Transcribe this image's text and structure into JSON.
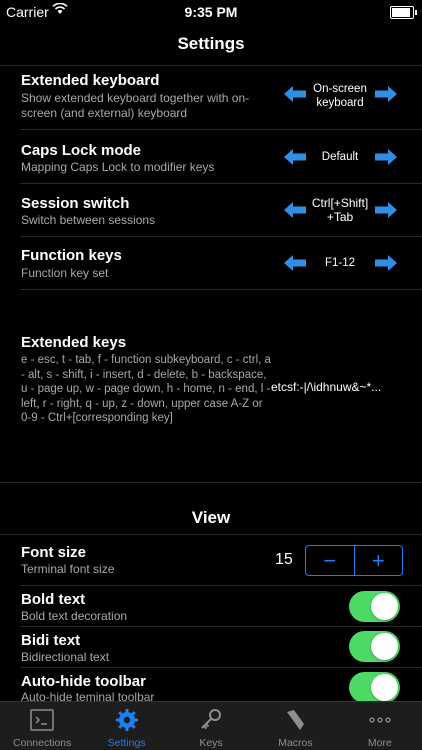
{
  "status_bar": {
    "carrier": "Carrier",
    "time": "9:35 PM",
    "battery_level": 1.0
  },
  "nav": {
    "title": "Settings"
  },
  "settings": {
    "extended_keyboard": {
      "title": "Extended keyboard",
      "subtitle": "Show extended keyboard together with on-screen (and external) keyboard",
      "value": "On-screen keyboard"
    },
    "caps_lock": {
      "title": "Caps Lock mode",
      "subtitle": "Mapping Caps Lock to modifier keys",
      "value": "Default"
    },
    "session_switch": {
      "title": "Session switch",
      "subtitle": "Switch between sessions",
      "value": "Ctrl[+Shift] +Tab"
    },
    "function_keys": {
      "title": "Function keys",
      "subtitle": "Function key set",
      "value": "F1-12"
    },
    "extended_keys": {
      "title": "Extended keys",
      "description": "e - esc, t - tab, f - function subkeyboard, c - ctrl, a - alt, s - shift, i - insert, d - delete, b - backspace, u - page up, w - page down, h - home, n - end, l - left, r - right, q - up, z - down, upper case A-Z or 0-9 - Ctrl+[corresponding key]",
      "value": "etcsf:-|/\\idhnuw&~*..."
    }
  },
  "view_section": {
    "header": "View",
    "font_size": {
      "title": "Font size",
      "subtitle": "Terminal font size",
      "value": "15",
      "minus": "−",
      "plus": "+"
    },
    "bold_text": {
      "title": "Bold text",
      "subtitle": "Bold text decoration",
      "on": true
    },
    "bidi_text": {
      "title": "Bidi text",
      "subtitle": "Bidirectional text",
      "on": true
    },
    "auto_hide": {
      "title": "Auto-hide toolbar",
      "subtitle": "Auto-hide teminal toolbar",
      "on": true
    }
  },
  "tabs": [
    {
      "label": "Connections",
      "icon": "terminal-icon",
      "active": false
    },
    {
      "label": "Settings",
      "icon": "gear-icon",
      "active": true
    },
    {
      "label": "Keys",
      "icon": "key-icon",
      "active": false
    },
    {
      "label": "Macros",
      "icon": "bookmark-icon",
      "active": false
    },
    {
      "label": "More",
      "icon": "more-icon",
      "active": false
    }
  ],
  "colors": {
    "accent": "#1d7ff0",
    "switch_on": "#4cd964",
    "arrow": "#2f8fe6"
  }
}
